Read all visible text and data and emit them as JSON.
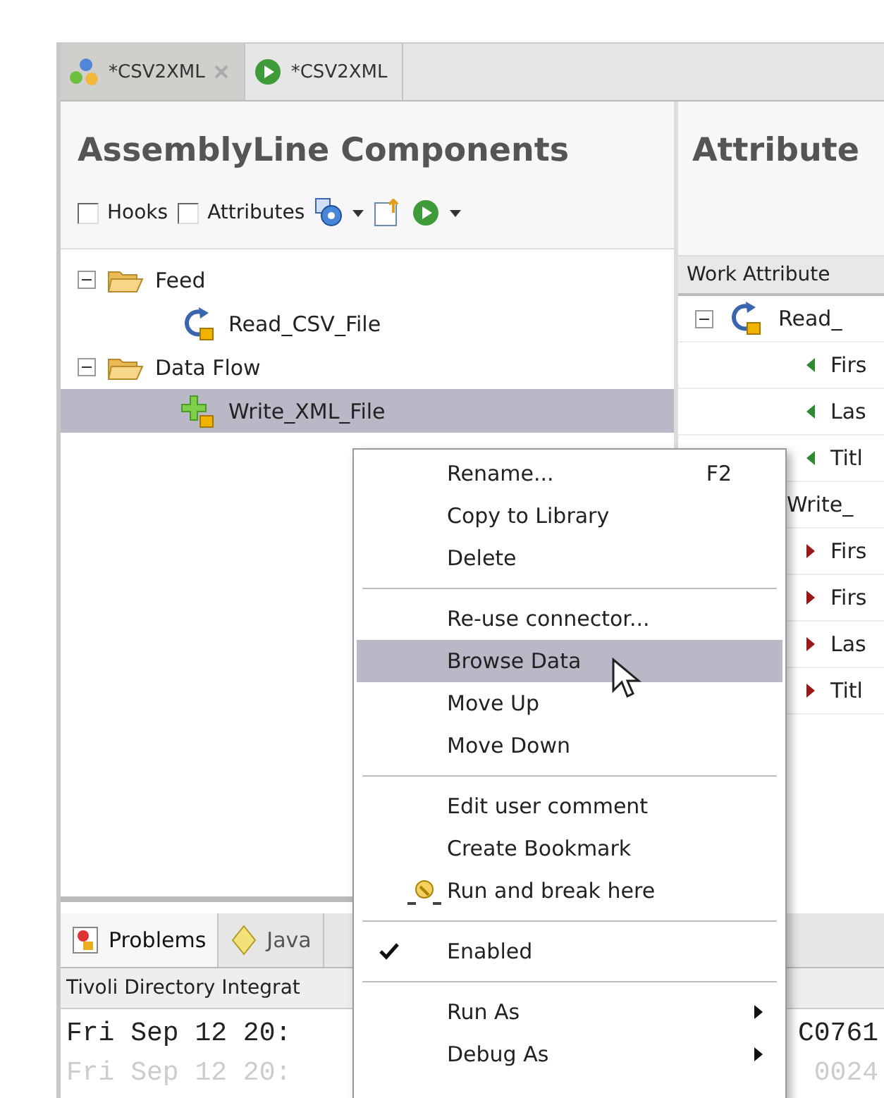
{
  "editor_tabs": [
    {
      "label": "*CSV2XML",
      "selected": true,
      "kind": "assembly",
      "closable": true
    },
    {
      "label": "*CSV2XML",
      "selected": false,
      "kind": "run",
      "closable": false
    }
  ],
  "left_panel": {
    "title": "AssemblyLine Components",
    "toolbar": {
      "checkboxes": [
        {
          "label": "Hooks",
          "checked": false
        },
        {
          "label": "Attributes",
          "checked": false
        }
      ]
    },
    "tree": [
      {
        "label": "Feed",
        "kind": "folder",
        "expanded": true,
        "selected": false,
        "children": [
          {
            "label": "Read_CSV_File",
            "kind": "iterator",
            "selected": false
          }
        ]
      },
      {
        "label": "Data Flow",
        "kind": "folder",
        "expanded": true,
        "selected": false,
        "children": [
          {
            "label": "Write_XML_File",
            "kind": "adder",
            "selected": true
          }
        ]
      }
    ]
  },
  "right_panel": {
    "title": "Attribute",
    "column": "Work Attribute",
    "rows": [
      {
        "label": "Read_",
        "kind": "iterator",
        "expanded": true,
        "children": [
          {
            "label": "Firs",
            "kind": "input"
          },
          {
            "label": "Las",
            "kind": "input"
          },
          {
            "label": "Titl",
            "kind": "input"
          }
        ]
      },
      {
        "label": "Write_",
        "kind": "plain",
        "children": [
          {
            "label": "Firs",
            "kind": "output"
          },
          {
            "label": "Firs",
            "kind": "output"
          },
          {
            "label": "Las",
            "kind": "output"
          },
          {
            "label": "Titl",
            "kind": "output"
          }
        ]
      }
    ]
  },
  "bottom_tabs": [
    {
      "label": "Problems",
      "kind": "problems",
      "selected": true
    },
    {
      "label": "Java",
      "kind": "java",
      "selected": false
    }
  ],
  "console": {
    "title": "Tivoli Directory Integrat",
    "lines": [
      {
        "text": "Fri Sep 12 20:",
        "tail": "C0761"
      },
      {
        "text": "Fri Sep 12 20:",
        "tail": "0024"
      }
    ]
  },
  "context_menu": {
    "groups": [
      [
        {
          "label": "Rename...",
          "shortcut": "F2",
          "kind": "plain",
          "selected": false,
          "checked": false,
          "submenu": false
        },
        {
          "label": "Copy to Library",
          "kind": "plain",
          "selected": false,
          "checked": false,
          "submenu": false
        },
        {
          "label": "Delete",
          "kind": "plain",
          "selected": false,
          "checked": false,
          "submenu": false
        }
      ],
      [
        {
          "label": "Re-use connector...",
          "kind": "plain",
          "selected": false,
          "checked": false,
          "submenu": false
        },
        {
          "label": "Browse Data",
          "kind": "plain",
          "selected": true,
          "checked": false,
          "submenu": false
        },
        {
          "label": "Move Up",
          "kind": "plain",
          "selected": false,
          "checked": false,
          "submenu": false
        },
        {
          "label": "Move Down",
          "kind": "plain",
          "selected": false,
          "checked": false,
          "submenu": false
        }
      ],
      [
        {
          "label": "Edit user comment",
          "kind": "plain",
          "selected": false,
          "checked": false,
          "submenu": false
        },
        {
          "label": "Create Bookmark",
          "kind": "plain",
          "selected": false,
          "checked": false,
          "submenu": false
        },
        {
          "label": "Run and break here",
          "kind": "breakpoint",
          "selected": false,
          "checked": false,
          "submenu": false
        }
      ],
      [
        {
          "label": "Enabled",
          "kind": "plain",
          "selected": false,
          "checked": true,
          "submenu": false
        }
      ],
      [
        {
          "label": "Run As",
          "kind": "plain",
          "selected": false,
          "checked": false,
          "submenu": true
        },
        {
          "label": "Debug As",
          "kind": "plain",
          "selected": false,
          "checked": false,
          "submenu": true
        }
      ]
    ]
  }
}
